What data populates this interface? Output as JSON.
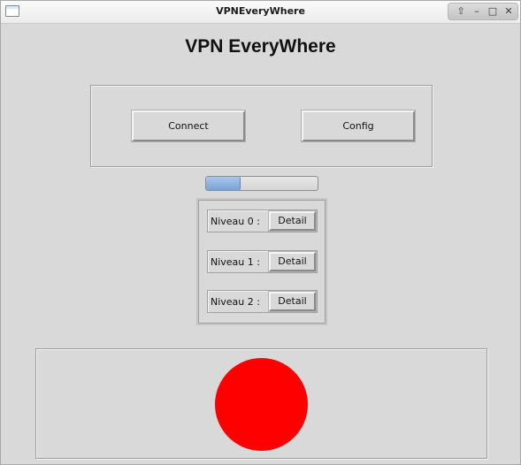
{
  "window": {
    "title": "VPNEveryWhere",
    "controls": {
      "up_icon": "up-arrow-icon",
      "minimize_icon": "minimize-icon",
      "maximize_icon": "maximize-icon",
      "close_icon": "close-icon",
      "up_glyph": "⇧",
      "minimize_glyph": "–",
      "maximize_glyph": "□",
      "close_glyph": "✕"
    }
  },
  "header": {
    "title": "VPN EveryWhere"
  },
  "actions": {
    "connect_label": "Connect",
    "config_label": "Config"
  },
  "progress": {
    "value": 0.3
  },
  "levels": [
    {
      "label": "Niveau 0 :",
      "button": "Detail"
    },
    {
      "label": "Niveau 1 :",
      "button": "Detail"
    },
    {
      "label": "Niveau 2 :",
      "button": "Detail"
    }
  ],
  "status": {
    "indicator_color": "#ff0000"
  },
  "colors": {
    "window_bg": "#d9d9d9",
    "progress_fill": "#7aa2d6"
  }
}
